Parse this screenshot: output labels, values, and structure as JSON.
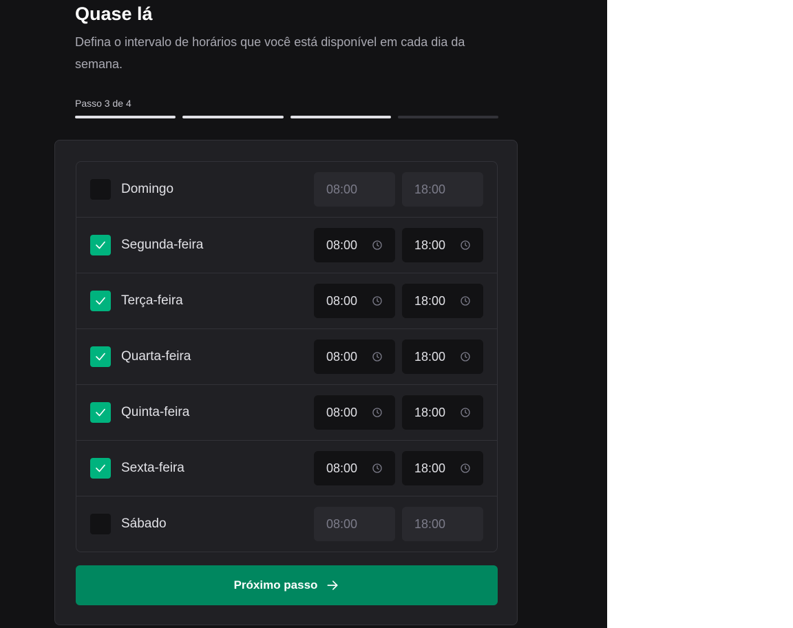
{
  "header": {
    "title": "Quase lá",
    "subtitle": "Defina o intervalo de horários que você está disponível em cada dia da semana.",
    "step_label": "Passo 3 de 4",
    "steps_total": 4,
    "steps_completed": 3
  },
  "days": [
    {
      "name": "Domingo",
      "enabled": false,
      "start": "08:00",
      "end": "18:00"
    },
    {
      "name": "Segunda-feira",
      "enabled": true,
      "start": "08:00",
      "end": "18:00"
    },
    {
      "name": "Terça-feira",
      "enabled": true,
      "start": "08:00",
      "end": "18:00"
    },
    {
      "name": "Quarta-feira",
      "enabled": true,
      "start": "08:00",
      "end": "18:00"
    },
    {
      "name": "Quinta-feira",
      "enabled": true,
      "start": "08:00",
      "end": "18:00"
    },
    {
      "name": "Sexta-feira",
      "enabled": true,
      "start": "08:00",
      "end": "18:00"
    },
    {
      "name": "Sábado",
      "enabled": false,
      "start": "08:00",
      "end": "18:00"
    }
  ],
  "next_button": {
    "label": "Próximo passo",
    "icon": "arrow-right-icon"
  },
  "colors": {
    "background": "#121214",
    "card": "#202024",
    "accent": "#00b37e",
    "button": "#00875f",
    "text": "#e1e1e6"
  },
  "icons": {
    "checkbox": "check-icon",
    "time_input": "clock-icon"
  }
}
